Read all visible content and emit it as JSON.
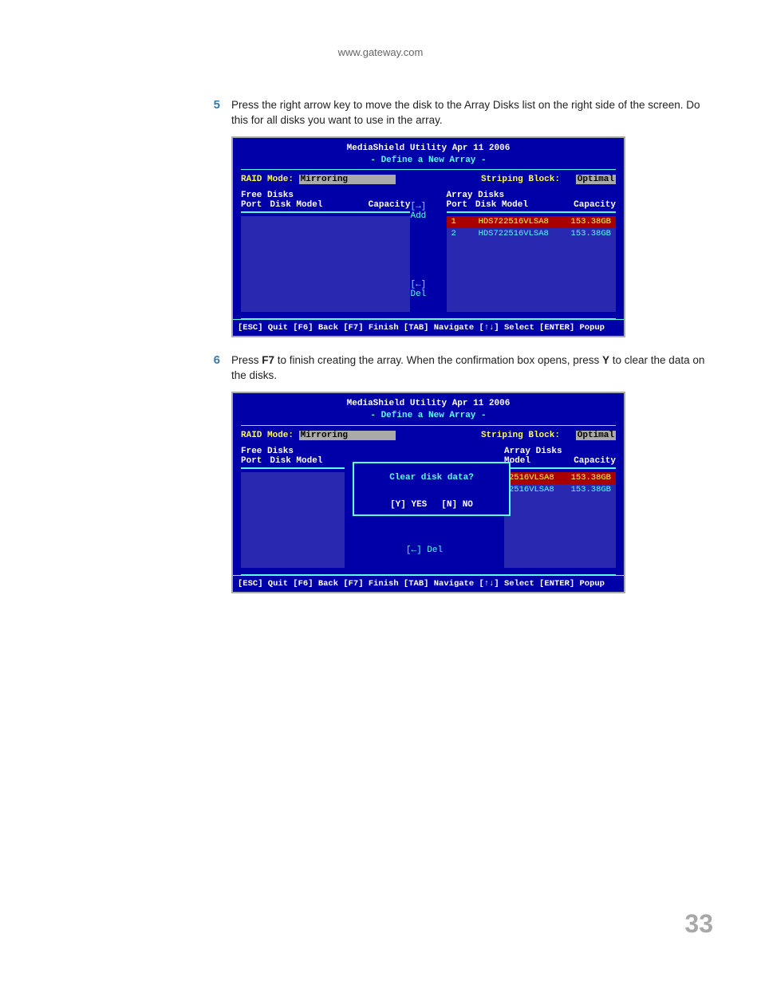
{
  "header_url": "www.gateway.com",
  "page_number": "33",
  "steps": {
    "s5": {
      "num": "5",
      "text_before": "Press the right arrow key to move the disk to the Array Disks list on the right side of the screen. Do this for all disks you want to use in the array."
    },
    "s6": {
      "num": "6",
      "text_a": "Press ",
      "f7": "F7",
      "text_b": " to finish creating the array. When the confirmation box opens, press ",
      "y": "Y",
      "text_c": " to clear the data on the disks."
    }
  },
  "bios_common": {
    "title_line1": "MediaShield Utility   Apr 11 2006",
    "title_line2": "- Define a New Array -",
    "raid_mode_label": "RAID Mode:",
    "raid_mode_value": "Mirroring",
    "striping_label": "Striping Block:",
    "striping_value": "Optimal",
    "free_disks": "Free Disks",
    "array_disks": "Array Disks",
    "port": "Port",
    "disk_model": "Disk Model",
    "model": "Model",
    "capacity": "Capacity",
    "add": "[→] Add",
    "del": "[←] Del",
    "footer": "[ESC] Quit [F6] Back [F7] Finish [TAB] Navigate [↑↓] Select [ENTER] Popup"
  },
  "bios1": {
    "rows": [
      {
        "port": "1",
        "model": "HDS722516VLSA8",
        "cap": "153.38GB",
        "sel": true
      },
      {
        "port": "2",
        "model": "HDS722516VLSA8",
        "cap": "153.38GB",
        "sel": false
      }
    ]
  },
  "bios2": {
    "dialog_q": "Clear disk data?",
    "dialog_yes": "[Y] YES",
    "dialog_no": "[N] NO",
    "rows": [
      {
        "model": "2516VLSA8",
        "cap": "153.38GB",
        "sel": true
      },
      {
        "model": "2516VLSA8",
        "cap": "153.38GB",
        "sel": false
      }
    ]
  }
}
